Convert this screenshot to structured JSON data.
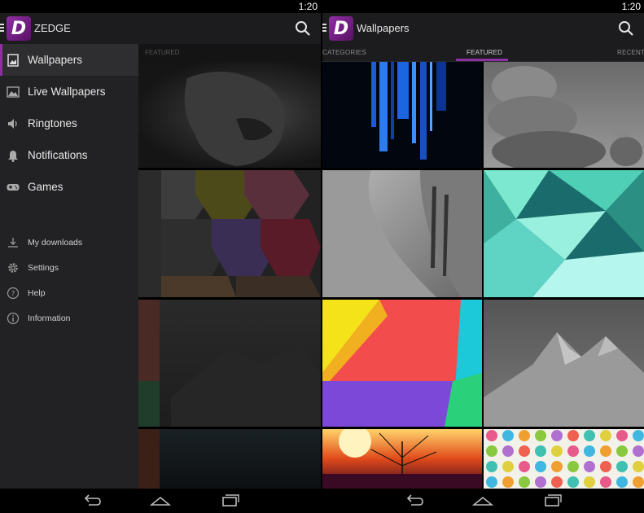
{
  "left": {
    "status": {
      "time": "1:20"
    },
    "actionbar": {
      "title": "ZEDGE",
      "logo_letter": "D"
    },
    "tabs": {
      "featured": "FEATURED"
    },
    "drawer": {
      "items": [
        {
          "label": "Wallpapers",
          "icon": "image-icon",
          "active": true
        },
        {
          "label": "Live Wallpapers",
          "icon": "landscape-icon",
          "active": false
        },
        {
          "label": "Ringtones",
          "icon": "speaker-icon",
          "active": false
        },
        {
          "label": "Notifications",
          "icon": "bell-icon",
          "active": false
        },
        {
          "label": "Games",
          "icon": "gamepad-icon",
          "active": false
        }
      ],
      "secondary": [
        {
          "label": "My downloads",
          "icon": "download-icon"
        },
        {
          "label": "Settings",
          "icon": "gear-icon"
        },
        {
          "label": "Help",
          "icon": "help-icon"
        },
        {
          "label": "Information",
          "icon": "info-icon"
        }
      ]
    }
  },
  "right": {
    "status": {
      "time": "1:20"
    },
    "actionbar": {
      "title": "Wallpapers",
      "logo_letter": "D"
    },
    "tabs": [
      {
        "label": "CATEGORIES",
        "active": false
      },
      {
        "label": "FEATURED",
        "active": true
      },
      {
        "label": "RECENT",
        "active": false
      }
    ]
  },
  "colors": {
    "accent": "#8e2fa3",
    "actionbar": "#1c1c1e",
    "drawer": "#222224"
  }
}
